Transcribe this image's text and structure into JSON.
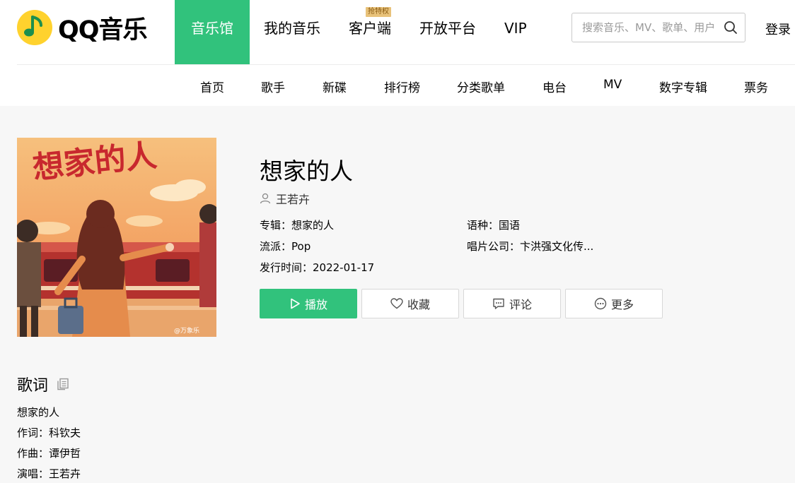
{
  "header": {
    "logo_text": "QQ音乐",
    "nav": [
      {
        "label": "音乐馆",
        "active": true
      },
      {
        "label": "我的音乐"
      },
      {
        "label": "客户端",
        "badge": "抢特权"
      },
      {
        "label": "开放平台"
      },
      {
        "label": "VIP"
      }
    ],
    "search_placeholder": "搜索音乐、MV、歌单、用户",
    "login": "登录"
  },
  "subnav": [
    "首页",
    "歌手",
    "新碟",
    "排行榜",
    "分类歌单",
    "电台",
    "MV",
    "数字专辑",
    "票务"
  ],
  "song": {
    "title": "想家的人",
    "singer": "王若卉",
    "album_label": "专辑：想家的人",
    "genre_label": "流派：Pop",
    "release_label": "发行时间：2022-01-17",
    "language_label": "语种：国语",
    "company_label": "唱片公司：卞洪强文化传...",
    "cover_text": "想家的人",
    "cover_watermark": "@万象乐"
  },
  "actions": {
    "play": "播放",
    "favorite": "收藏",
    "comment": "评论",
    "more": "更多"
  },
  "lyrics": {
    "heading": "歌词",
    "lines": [
      "想家的人",
      "作词：科钦夫",
      "作曲：谭伊哲",
      "演唱：王若卉"
    ]
  },
  "colors": {
    "brand_green": "#31c27c",
    "logo_yellow": "#ffd22e"
  }
}
